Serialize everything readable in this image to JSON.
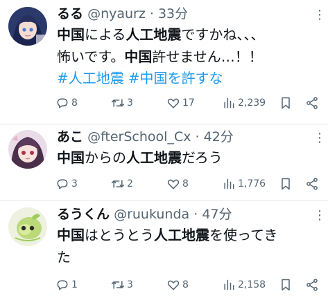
{
  "tweets": [
    {
      "name": "るる",
      "handle": "@nyaurz",
      "dot": "·",
      "time": "33分",
      "more": "⋮",
      "body_parts": [
        {
          "text": "中国",
          "bold": true
        },
        {
          "text": "による",
          "bold": false
        },
        {
          "text": "人工地震",
          "bold": true
        },
        {
          "text": "ですかね、、、",
          "bold": false
        }
      ],
      "body_line2": [
        {
          "text": "怖いです。",
          "bold": false
        },
        {
          "text": "中国",
          "bold": true
        },
        {
          "text": "許せません…！！",
          "bold": false
        }
      ],
      "hashtags": [
        "#人工地震",
        "#中国を許すな"
      ],
      "stats": {
        "replies": "8",
        "retweets": "3",
        "likes": "17",
        "views": "2,239"
      }
    },
    {
      "name": "あこ",
      "handle": "@fterSchool_Cx",
      "dot": "·",
      "time": "42分",
      "more": "⋮",
      "body_parts": [
        {
          "text": "中国",
          "bold": true
        },
        {
          "text": "からの",
          "bold": false
        },
        {
          "text": "人工地震",
          "bold": true
        },
        {
          "text": "だろう",
          "bold": false
        }
      ],
      "stats": {
        "replies": "3",
        "retweets": "2",
        "likes": "8",
        "views": "1,776"
      }
    },
    {
      "name": "るうくん",
      "handle": "@ruukunda",
      "dot": "·",
      "time": "47分",
      "more": "⋮",
      "body_parts": [
        {
          "text": "中国",
          "bold": true
        },
        {
          "text": "はとうとう",
          "bold": false
        },
        {
          "text": "人工地震",
          "bold": true
        },
        {
          "text": "を使ってき",
          "bold": false
        }
      ],
      "body_line2": [
        {
          "text": "た",
          "bold": false
        }
      ],
      "stats": {
        "replies": "1",
        "retweets": "3",
        "likes": "8",
        "views": "2,158"
      }
    }
  ],
  "icons": {
    "reply": "reply-icon",
    "retweet": "retweet-icon",
    "like": "heart-icon",
    "views": "views-icon",
    "bookmark": "bookmark-icon",
    "share": "share-icon"
  },
  "colors": {
    "text": "#0f1419",
    "secondary": "#536471",
    "link": "#1d9bf0",
    "divider": "#e6e9eb"
  }
}
